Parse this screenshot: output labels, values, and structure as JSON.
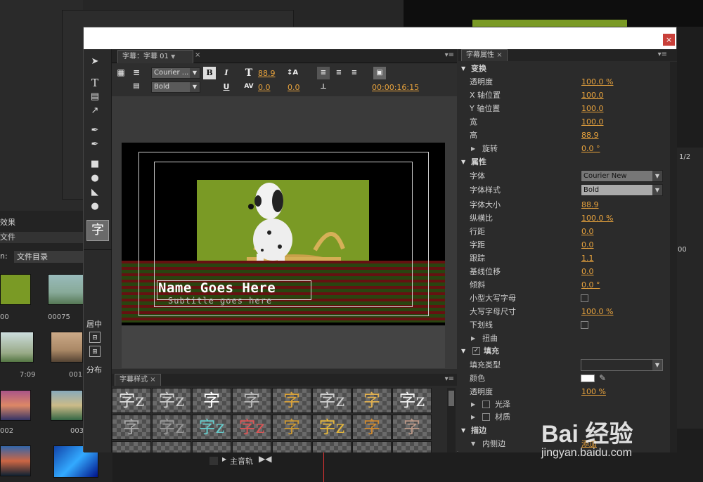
{
  "background": {
    "project_tab": "效果",
    "file_menu": "文件",
    "file_dir_label": "文件目录",
    "thumbs": [
      "00",
      "00075",
      "7:09",
      "001",
      "002",
      "003"
    ],
    "page_indicator": "1/2",
    "timecode": "00",
    "master_track": "主音轨"
  },
  "dialog": {
    "close": "×",
    "tools": {
      "center_label": "居中",
      "distribute_label": "分布"
    },
    "editor": {
      "tab_label": "字幕：字幕 01",
      "font_family": "Courier ...",
      "font_style": "Bold",
      "bold_btn": "B",
      "italic_btn": "I",
      "underline_btn": "U",
      "font_size": "88.9",
      "tracking": "0.0",
      "kerning": "0.0",
      "leading": "1.1",
      "timecode": "00:00:16:15",
      "title_text": "Name Goes Here",
      "subtitle_text": "Subtitle goes here"
    },
    "styles": {
      "tab_label": "字幕样式",
      "swatch_glyphs": [
        "字z",
        "字z",
        "字",
        "字",
        "字",
        "字z",
        "字",
        "字z",
        "字",
        "字z",
        "字z",
        "字z",
        "字",
        "字z",
        "字",
        "字"
      ]
    },
    "props": {
      "tab_label": "字幕属性",
      "transform": {
        "section": "变换",
        "rows": [
          {
            "label": "透明度",
            "value": "100.0 %"
          },
          {
            "label": "X 轴位置",
            "value": "100.0"
          },
          {
            "label": "Y 轴位置",
            "value": "100.0"
          },
          {
            "label": "宽",
            "value": "100.0"
          },
          {
            "label": "高",
            "value": "88.9"
          },
          {
            "label": "旋转",
            "value": "0.0 °"
          }
        ]
      },
      "properties": {
        "section": "属性",
        "font_label": "字体",
        "font_value": "Courier New",
        "style_label": "字体样式",
        "style_value": "Bold",
        "rows": [
          {
            "label": "字体大小",
            "value": "88.9"
          },
          {
            "label": "纵横比",
            "value": "100.0 %"
          },
          {
            "label": "行距",
            "value": "0.0"
          },
          {
            "label": "字距",
            "value": "0.0"
          },
          {
            "label": "跟踪",
            "value": "1.1"
          },
          {
            "label": "基线位移",
            "value": "0.0"
          },
          {
            "label": "倾斜",
            "value": "0.0 °"
          }
        ],
        "smallcaps_label": "小型大写字母",
        "smallcaps_size_label": "大写字母尺寸",
        "smallcaps_size_value": "100.0 %",
        "underline_label": "下划线",
        "distort_label": "扭曲"
      },
      "fill": {
        "section": "填充",
        "type_label": "填充类型",
        "color_label": "颜色",
        "opacity_label": "透明度",
        "opacity_value": "100 %",
        "sheen_label": "光泽",
        "texture_label": "材质"
      },
      "stroke": {
        "section": "描边",
        "inner_label": "内侧边",
        "inner_add": "添加"
      }
    }
  },
  "watermark": {
    "brand": "Bai 经验",
    "url": "jingyan.baidu.com"
  },
  "colors": {
    "accent_value": "#e8a33d",
    "close": "#c9403a",
    "green_bg": "#7a9a25"
  }
}
